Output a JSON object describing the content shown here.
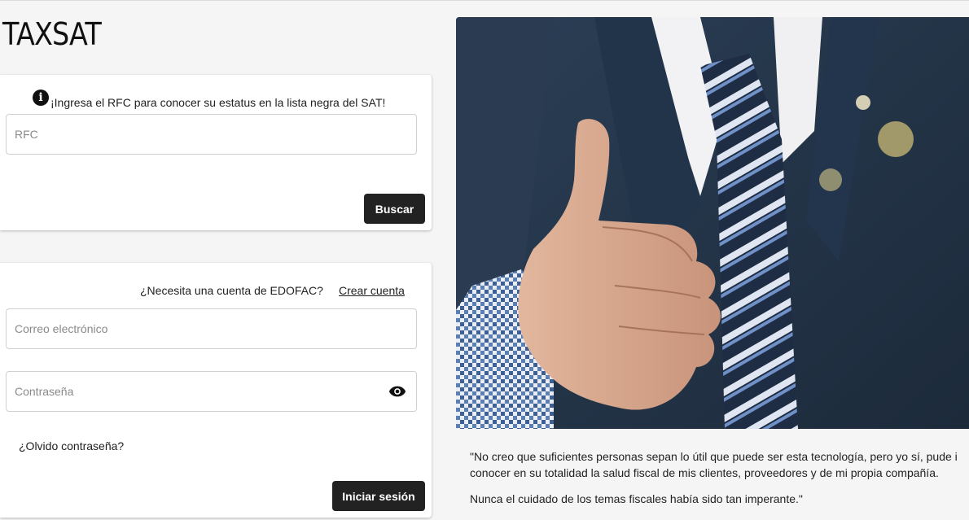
{
  "brand": {
    "logo": "TAXSAT"
  },
  "rfc_search": {
    "info_icon": "info-icon",
    "message": "¡Ingresa el RFC para conocer su estatus en la lista negra del SAT!",
    "rfc_placeholder": "RFC",
    "search_button": "Buscar"
  },
  "login": {
    "account_prompt": "¿Necesita una cuenta de EDOFAC?",
    "create_account_link": "Crear cuenta",
    "email_placeholder": "Correo electrónico",
    "password_placeholder": "Contraseña",
    "toggle_password_icon": "eye-icon",
    "forgot_password": "¿Olvido contraseña?",
    "login_button": "Iniciar sesión"
  },
  "testimonial": {
    "image": "businessman-thumbs-up-photo",
    "quote_line_1": "\"No creo que suficientes personas sepan lo útil que puede ser esta tecnología, pero yo sí, pude i",
    "quote_line_2": "conocer en su totalidad la salud fiscal de mis clientes, proveedores y de mi propia compañía.",
    "quote_line_3": "Nunca el cuidado de los temas fiscales había sido tan imperante.\""
  },
  "colors": {
    "background": "#f5f5f5",
    "button": "#222222",
    "card": "#ffffff"
  }
}
